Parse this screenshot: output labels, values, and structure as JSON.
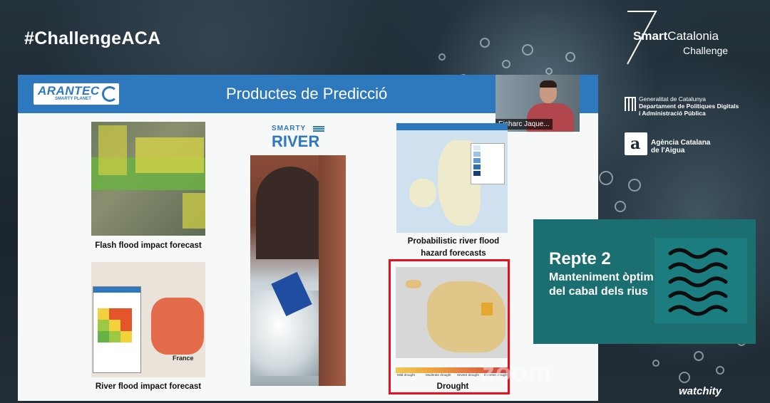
{
  "stream": {
    "hashtag": "#ChallengeACA",
    "brand_title_bold": "Smart",
    "brand_title_rest": "Catalonia",
    "brand_subtitle": "Challenge",
    "watermark": "watchity",
    "zoom_watermark": "zoom"
  },
  "sponsors": {
    "generalitat": [
      "Generalitat de Catalunya",
      "Departament de Polítiques Digitals",
      "i Administració Pública"
    ],
    "aca": [
      "Agència Catalana",
      "de l'Aigua"
    ]
  },
  "slide": {
    "company_logo": "ARANTEC",
    "company_tagline": "SMARTY PLANET",
    "title": "Productes de Predicció",
    "speaker_name": "Eisharc Jaque...",
    "smarty_top": "SMARTY",
    "smarty_bottom": "RIVER",
    "captions": {
      "flash": "Flash flood impact forecast",
      "prob_line1": "Probabilistic river flood",
      "prob_line2": "hazard forecasts",
      "river_flood": "River flood impact forecast",
      "drought": "Drought"
    },
    "map_label_france": "France",
    "highlight_color": "#e8101e"
  },
  "challenge": {
    "title": "Repte 2",
    "line1": "Manteniment òptim",
    "line2": "del cabal dels rius",
    "icon": "waves-icon",
    "color": "#1c6f70"
  }
}
